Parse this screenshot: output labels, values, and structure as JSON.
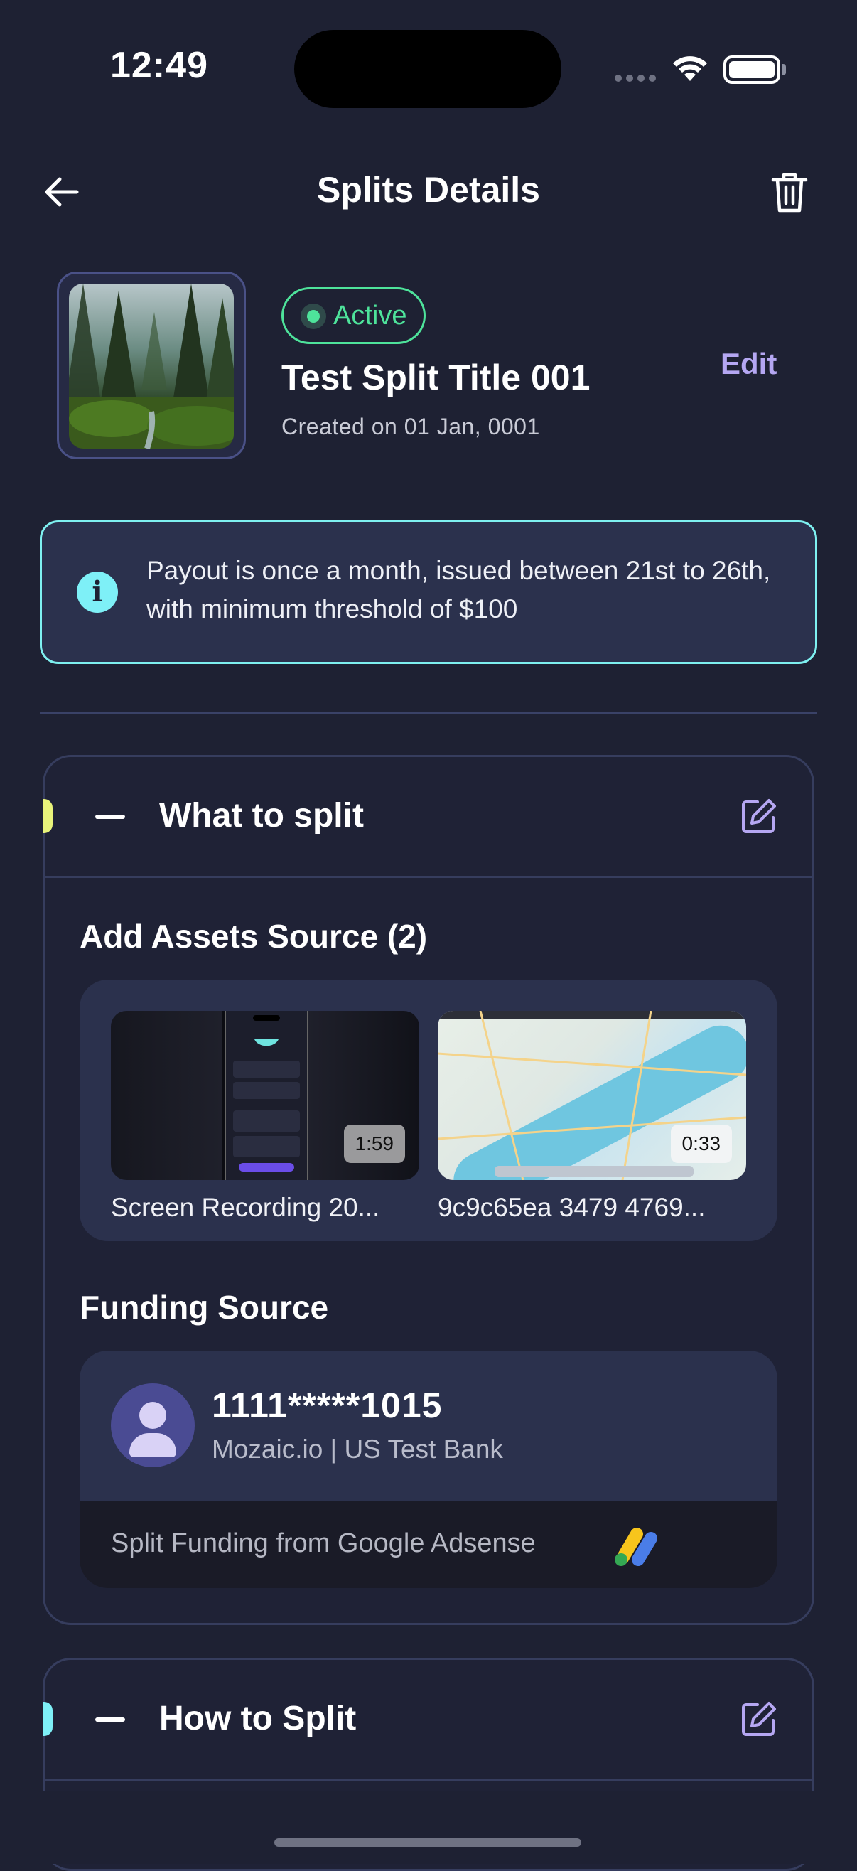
{
  "status_bar": {
    "time": "12:49"
  },
  "header": {
    "title": "Splits Details"
  },
  "split": {
    "status": "Active",
    "title": "Test Split Title 001",
    "created": "Created on 01 Jan, 0001",
    "edit_label": "Edit"
  },
  "info_banner": {
    "text": "Payout is once a month, issued between 21st to 26th, with minimum threshold of $100"
  },
  "sections": [
    {
      "title": "What to split",
      "accent": "#e8f37a"
    },
    {
      "title": "How to Split",
      "accent": "#7ef0f7"
    }
  ],
  "assets": {
    "title": "Add Assets Source (2)",
    "items": [
      {
        "name": "Screen Recording 20...",
        "duration": "1:59"
      },
      {
        "name": "9c9c65ea 3479 4769...",
        "duration": "0:33"
      }
    ]
  },
  "funding": {
    "title": "Funding Source",
    "account_number": "1111*****1015",
    "account_bank": "Mozaic.io | US Test Bank",
    "note": "Split Funding from Google Adsense"
  },
  "colors": {
    "background": "#1e2133",
    "card": "#2b314d",
    "active": "#4ee39b",
    "accent": "#b5a7f2",
    "info_border": "#7ef0f0"
  }
}
